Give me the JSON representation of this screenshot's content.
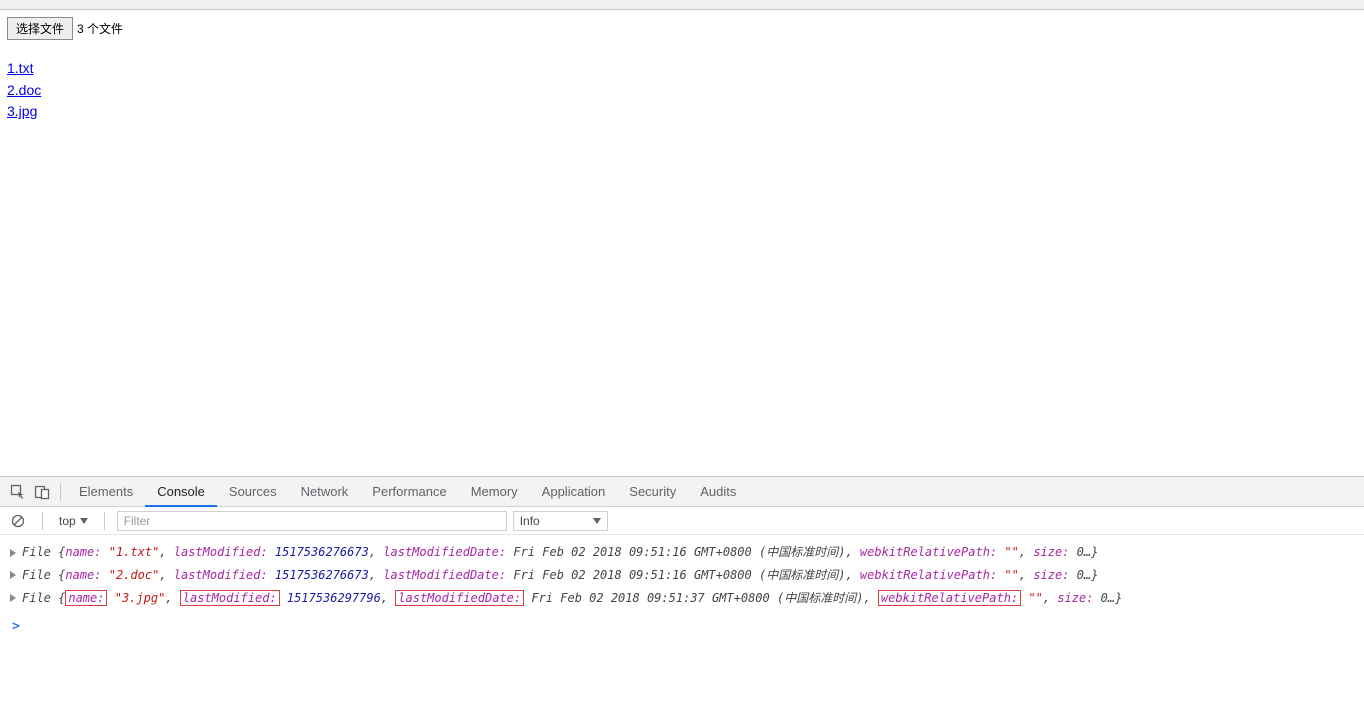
{
  "page": {
    "choose_file_label": "选择文件",
    "files_count_label": "3 个文件",
    "file_links": [
      "1.txt",
      "2.doc",
      "3.jpg"
    ]
  },
  "devtools": {
    "tabs": [
      "Elements",
      "Console",
      "Sources",
      "Network",
      "Performance",
      "Memory",
      "Application",
      "Security",
      "Audits"
    ],
    "active_tab": "Console",
    "subbar": {
      "context_label": "top",
      "filter_placeholder": "Filter",
      "level_label": "Info"
    },
    "prompt_symbol": ">"
  },
  "console_logs": [
    {
      "highlighted": false,
      "name": "1.txt",
      "lastModified": "1517536276673",
      "date": "Fri Feb 02 2018 09:51:16 GMT+0800 (中国标准时间)",
      "wrp": ""
    },
    {
      "highlighted": false,
      "name": "2.doc",
      "lastModified": "1517536276673",
      "date": "Fri Feb 02 2018 09:51:16 GMT+0800 (中国标准时间)",
      "wrp": ""
    },
    {
      "highlighted": true,
      "name": "3.jpg",
      "lastModified": "1517536297796",
      "date": "Fri Feb 02 2018 09:51:37 GMT+0800 (中国标准时间)",
      "wrp": ""
    }
  ],
  "tokens": {
    "file_prefix": "File",
    "brace_open": "{",
    "brace_close": "}",
    "name_key": "name:",
    "lastModified_key": "lastModified:",
    "lastModifiedDate_key": "lastModifiedDate:",
    "webkitRelativePath_key": "webkitRelativePath:",
    "size_key": "size:",
    "size_val": "0…",
    "comma": ",",
    "space": " "
  }
}
